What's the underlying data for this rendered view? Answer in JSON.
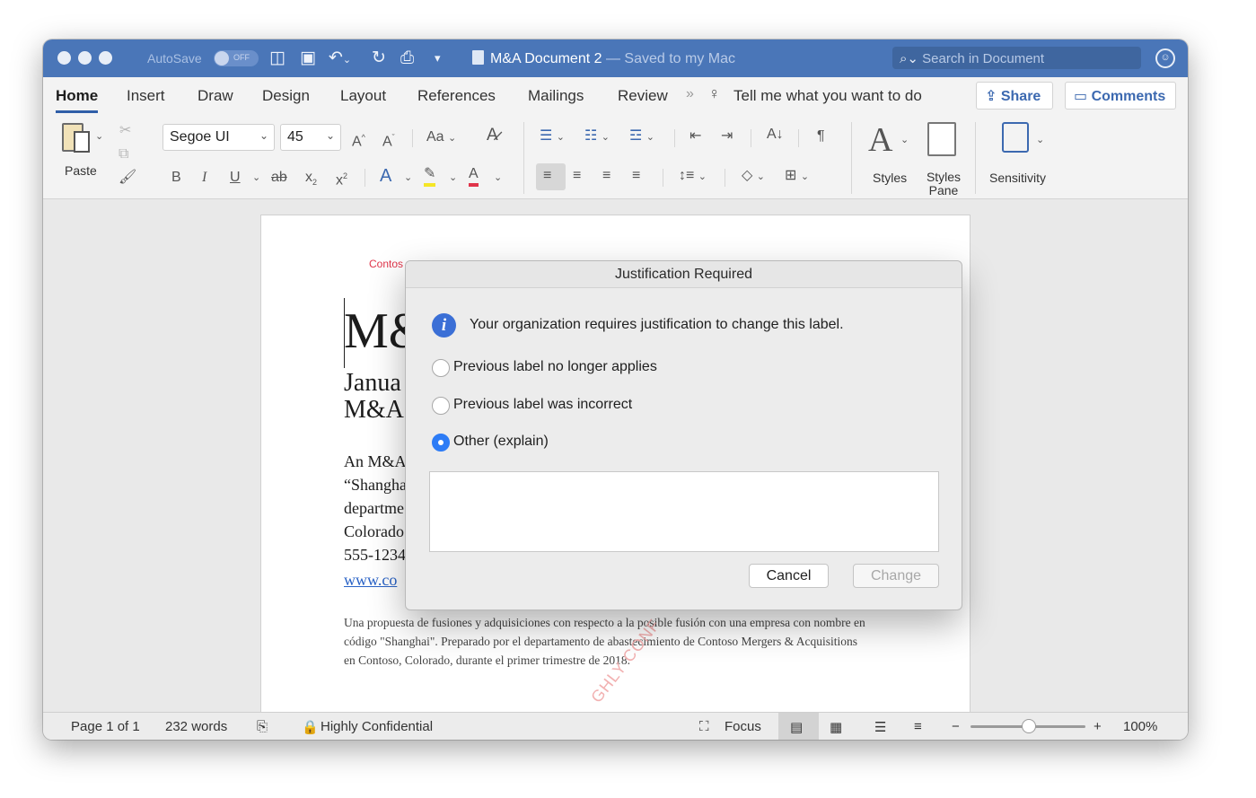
{
  "window": {
    "autosave_label": "AutoSave",
    "autosave_state": "OFF",
    "doc_name": "M&A Document 2",
    "doc_saved": " — Saved to my Mac",
    "search_placeholder": "Search in Document"
  },
  "tabs": [
    "Home",
    "Insert",
    "Draw",
    "Design",
    "Layout",
    "References",
    "Mailings",
    "Review"
  ],
  "tell_me": "Tell me what you want to do",
  "share_label": "Share",
  "comments_label": "Comments",
  "ribbon": {
    "paste_label": "Paste",
    "font_name": "Segoe UI",
    "font_size": "45",
    "bold": "B",
    "italic": "I",
    "underline": "U",
    "strike": "ab",
    "change_case": "Aa",
    "styles_label": "Styles",
    "styles_pane_line1": "Styles",
    "styles_pane_line2": "Pane",
    "sensitivity_label": "Sensitivity"
  },
  "document": {
    "header_fragment": "Contos",
    "title_fragment": "M&",
    "subtitle_line1": "Janua",
    "subtitle_line2": "M&A",
    "body_lines": [
      "An M&A",
      "“Shangha",
      "departme",
      "Colorado",
      "555-1234"
    ],
    "link_fragment": "www.co",
    "abstract_line1": "Una propuesta de fusiones y adquisiciones con respecto a la posible fusión con una empresa con nombre en",
    "abstract_line2": "código \"Shanghai\". Preparado por el departamento de abastecimiento de Contoso Mergers & Acquisitions",
    "abstract_line3": "en Contoso, Colorado, durante el primer trimestre de 2018.",
    "watermark": "GHLY CONF"
  },
  "status": {
    "page": "Page 1 of 1",
    "words": "232 words",
    "label": "Highly Confidential",
    "focus": "Focus",
    "zoom": "100%",
    "zoom_fraction": 0.5
  },
  "dialog": {
    "title": "Justification Required",
    "message": "Your organization requires justification to change this label.",
    "options": [
      {
        "label": "Previous label no longer applies",
        "selected": false
      },
      {
        "label": "Previous label was incorrect",
        "selected": false
      },
      {
        "label": "Other (explain)",
        "selected": true
      }
    ],
    "explain_value": "",
    "cancel_label": "Cancel",
    "change_label": "Change"
  },
  "colors": {
    "titlebar": "#4a76b8",
    "accent": "#2f5ea8",
    "radio_selected": "#2d7cf6",
    "header_red": "#e0344a"
  }
}
